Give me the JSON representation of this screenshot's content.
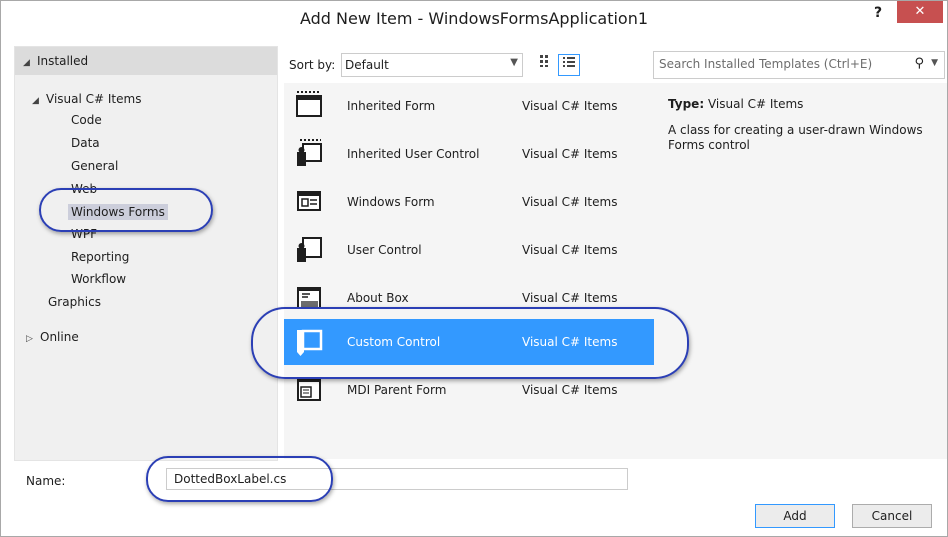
{
  "dialog": {
    "title": "Add New Item - WindowsFormsApplication1",
    "help_label": "?",
    "close_label": "✕"
  },
  "tree": {
    "installed_label": "Installed",
    "root_label": "Visual C# Items",
    "children": [
      "Code",
      "Data",
      "General",
      "Web",
      "Windows Forms",
      "WPF",
      "Reporting",
      "Workflow"
    ],
    "selected": "Windows Forms",
    "graphics_label": "Graphics",
    "online_label": "Online"
  },
  "toolbar": {
    "sort_label": "Sort by:",
    "sort_value": "Default"
  },
  "search": {
    "placeholder": "Search Installed Templates (Ctrl+E)"
  },
  "templates": [
    {
      "name": "Inherited Form",
      "category": "Visual C# Items",
      "icon": "inherited-form-icon"
    },
    {
      "name": "Inherited User Control",
      "category": "Visual C# Items",
      "icon": "inherited-user-control-icon"
    },
    {
      "name": "Windows Form",
      "category": "Visual C# Items",
      "icon": "windows-form-icon"
    },
    {
      "name": "User Control",
      "category": "Visual C# Items",
      "icon": "user-control-icon"
    },
    {
      "name": "About Box",
      "category": "Visual C# Items",
      "icon": "about-box-icon"
    },
    {
      "name": "Custom Control",
      "category": "Visual C# Items",
      "icon": "custom-control-icon"
    },
    {
      "name": "MDI Parent Form",
      "category": "Visual C# Items",
      "icon": "mdi-parent-form-icon"
    }
  ],
  "selected_template": "Custom Control",
  "details": {
    "type_label": "Type:",
    "type_value": "Visual C# Items",
    "description": "A class for creating a user-drawn Windows Forms control"
  },
  "name_field": {
    "label": "Name:",
    "value": "DottedBoxLabel.cs"
  },
  "buttons": {
    "add": "Add",
    "cancel": "Cancel"
  },
  "colors": {
    "selection": "#3399ff",
    "callout": "#2b3fb5",
    "close": "#c75050"
  }
}
